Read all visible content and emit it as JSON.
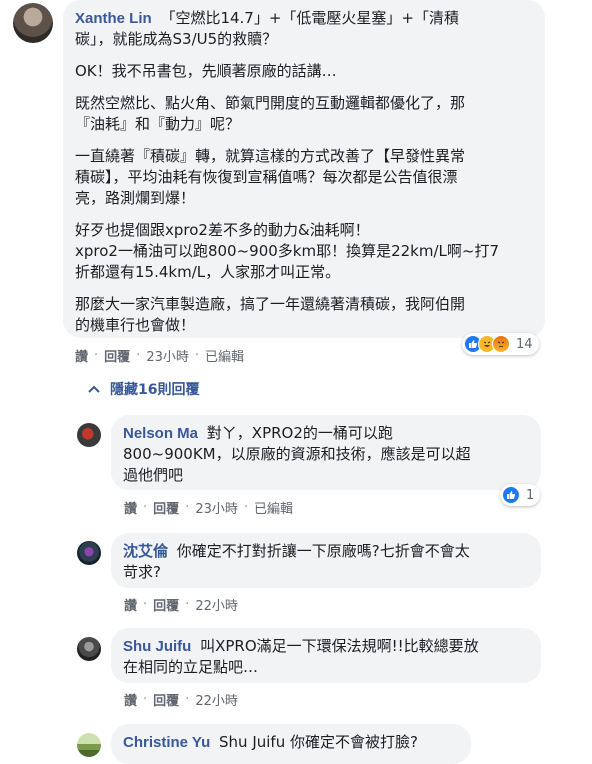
{
  "main_comment": {
    "author": "Xanthe Lin",
    "first_line": "「空燃比14.7」+「低電壓火星塞」+「清積",
    "second_line": "碳」，就能成為S3/U5的救贖？",
    "paragraphs": [
      [
        "OK！我不吊書包，先順著原廠的話講…"
      ],
      [
        "既然空燃比、點火角、節氣門開度的互動邏輯都優化了，那",
        "『油耗』和『動力』呢？"
      ],
      [
        "一直繞著『積碳』轉，就算這樣的方式改善了【早發性異常",
        "積碳】，平均油耗有恢復到宣稱值嗎？每次都是公告值很漂",
        "亮，路測爛到爆！"
      ],
      [
        "好歹也提個跟xpro2差不多的動力&油耗啊！",
        "xpro2一桶油可以跑800~900多km耶！換算是22km/L啊~打7",
        "折都還有15.4km/L，人家那才叫正常。"
      ],
      [
        "那麼大一家汽車製造廠，搞了一年還繞著清積碳，我阿伯開",
        "的機車行也會做！"
      ]
    ],
    "actions": {
      "like": "讚",
      "reply": "回覆",
      "time": "23小時",
      "edited": "已編輯"
    },
    "reactions": {
      "count": "14"
    }
  },
  "hidden_replies": {
    "label": "隱藏16則回覆"
  },
  "replies": [
    {
      "author": "Nelson Ma",
      "lines": [
        "對ㄚ，XPRO2的一桶可以跑",
        "800~900KM，以原廠的資源和技術，應該是可以超",
        "過他們吧"
      ],
      "actions": {
        "like": "讚",
        "reply": "回覆",
        "time": "23小時",
        "edited": "已編輯"
      },
      "reactions": {
        "count": "1"
      }
    },
    {
      "author": "沈艾倫",
      "lines": [
        "你確定不打對折讓一下原廠嗎?七折會不會太",
        "苛求?"
      ],
      "actions": {
        "like": "讚",
        "reply": "回覆",
        "time": "22小時"
      }
    },
    {
      "author": "Shu Juifu",
      "lines": [
        "叫XPRO滿足一下環保法規啊!!比較總要放",
        "在相同的立足點吧…"
      ],
      "actions": {
        "like": "讚",
        "reply": "回覆",
        "time": "22小時"
      }
    },
    {
      "author": "Christine Yu",
      "lines": [
        "Shu Juifu 你確定不會被打臉?"
      ]
    }
  ],
  "colors": {
    "name": "#385898",
    "bubble": "#f2f3f5",
    "meta": "#606770",
    "like_blue": "#2078f4",
    "haha_yellow": "#f7b928",
    "angry_orange": "#e9710f"
  }
}
